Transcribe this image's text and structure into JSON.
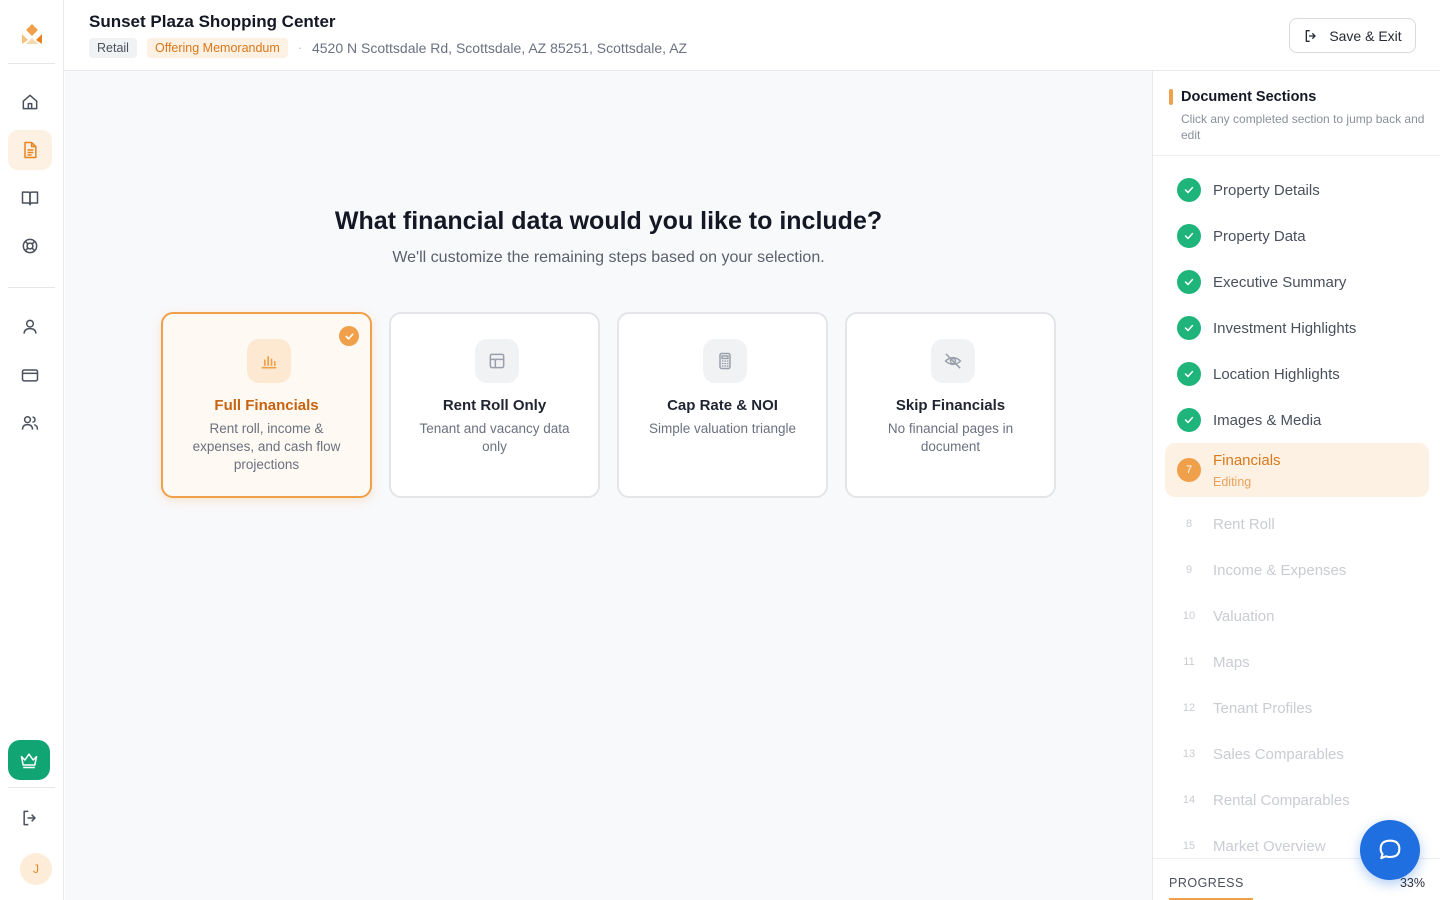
{
  "header": {
    "title": "Sunset Plaza Shopping Center",
    "tag_type": "Retail",
    "tag_doc": "Offering Memorandum",
    "separator": "·",
    "address": "4520 N Scottsdale Rd, Scottsdale, AZ 85251, Scottsdale, AZ",
    "save_label": "Save & Exit"
  },
  "rail": {
    "nav_icons": [
      "home-icon",
      "document-icon",
      "book-icon",
      "lifebuoy-icon",
      "user-icon",
      "card-icon",
      "users-icon"
    ],
    "active": "document-icon",
    "avatar_initial": "J",
    "accent": "#12a574"
  },
  "main": {
    "question": "What financial data would you like to include?",
    "subtitle": "We'll customize the remaining steps based on your selection.",
    "options": [
      {
        "title": "Full Financials",
        "desc": "Rent roll, income & expenses, and cash flow projections",
        "icon": "bar-chart-icon",
        "selected": true
      },
      {
        "title": "Rent Roll Only",
        "desc": "Tenant and vacancy data only",
        "icon": "table-icon",
        "selected": false
      },
      {
        "title": "Cap Rate & NOI",
        "desc": "Simple valuation triangle",
        "icon": "calculator-icon",
        "selected": false
      },
      {
        "title": "Skip Financials",
        "desc": "No financial pages in document",
        "icon": "eye-off-icon",
        "selected": false
      }
    ]
  },
  "panel": {
    "heading": "Document Sections",
    "description": "Click any completed section to jump back and edit",
    "sections": [
      {
        "num": "1",
        "label": "Property Details",
        "state": "done"
      },
      {
        "num": "2",
        "label": "Property Data",
        "state": "done"
      },
      {
        "num": "3",
        "label": "Executive Summary",
        "state": "done"
      },
      {
        "num": "4",
        "label": "Investment Highlights",
        "state": "done"
      },
      {
        "num": "5",
        "label": "Location Highlights",
        "state": "done"
      },
      {
        "num": "6",
        "label": "Images & Media",
        "state": "done"
      },
      {
        "num": "7",
        "label": "Financials",
        "state": "current",
        "sub": "Editing"
      },
      {
        "num": "8",
        "label": "Rent Roll",
        "state": "todo"
      },
      {
        "num": "9",
        "label": "Income & Expenses",
        "state": "todo"
      },
      {
        "num": "10",
        "label": "Valuation",
        "state": "todo"
      },
      {
        "num": "11",
        "label": "Maps",
        "state": "todo"
      },
      {
        "num": "12",
        "label": "Tenant Profiles",
        "state": "todo"
      },
      {
        "num": "13",
        "label": "Sales Comparables",
        "state": "todo"
      },
      {
        "num": "14",
        "label": "Rental Comparables",
        "state": "todo"
      },
      {
        "num": "15",
        "label": "Market Overview",
        "state": "todo"
      }
    ],
    "progress_label": "PROGRESS",
    "progress_value": "33%",
    "progress_fraction": 0.33
  },
  "colors": {
    "accent": "#f0a04b",
    "done": "#1fb57a",
    "chat": "#1f6fe0"
  }
}
